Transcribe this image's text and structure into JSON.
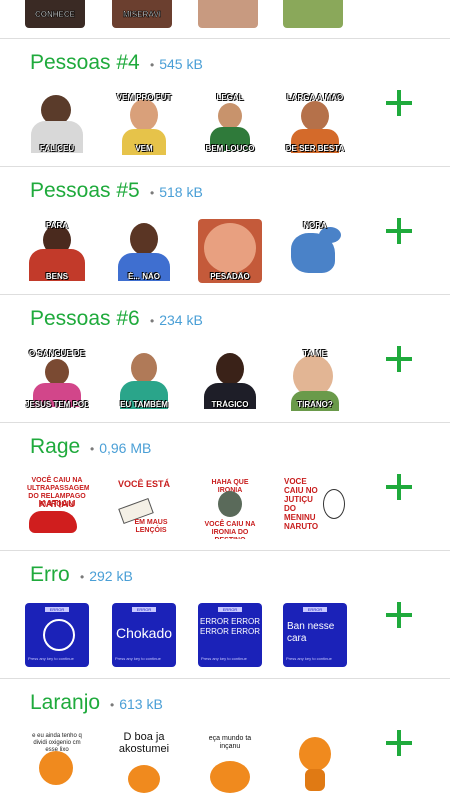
{
  "top_row": {
    "captions": [
      "CONHECE",
      "MISERAVI",
      "",
      ""
    ]
  },
  "packs": [
    {
      "title": "Pessoas #4",
      "size": "545 kB",
      "stickers": [
        {
          "top": "",
          "bottom": "FALICEU"
        },
        {
          "top": "VEM PRO FUT",
          "bottom": "VEM"
        },
        {
          "top": "LEGAL",
          "bottom": "BEM LOUCO"
        },
        {
          "top": "LARGA A MÃO",
          "bottom": "DE SER BESTA"
        }
      ]
    },
    {
      "title": "Pessoas #5",
      "size": "518 kB",
      "stickers": [
        {
          "top": "PARA",
          "bottom": "BENS"
        },
        {
          "top": "",
          "bottom": "É... NÃO"
        },
        {
          "top": "",
          "bottom": "PESADÃO"
        },
        {
          "top": "NORA",
          "bottom": ""
        }
      ]
    },
    {
      "title": "Pessoas #6",
      "size": "234 kB",
      "stickers": [
        {
          "top": "O SANGUE DE",
          "bottom": "JESUS TEM PODER"
        },
        {
          "top": "",
          "bottom": "EU TAMBÉM"
        },
        {
          "top": "",
          "bottom": "TRÁGICO"
        },
        {
          "top": "TA ME",
          "bottom": "TIRANO?"
        }
      ]
    },
    {
      "title": "Rage",
      "size": "0,96 MB",
      "stickers": [
        {
          "line1": "VOCÊ CAIU NA ULTRAPASSAGEM DO RELAMPAGO MARQUIN",
          "line2": "KATIAU"
        },
        {
          "line1": "VOCÊ ESTÁ",
          "line2": "EM MAUS LENÇÓIS"
        },
        {
          "line1": "HAHA QUE IRONIA",
          "line2": "VOCÊ CAIU NA IRONIA DO DESTINO"
        },
        {
          "line1": "VOCE CAIU NO JUTIÇU DO MENINU NARUTO",
          "line2": ""
        }
      ]
    },
    {
      "title": "Erro",
      "size": "292 kB",
      "stickers": [
        {
          "header": "ERROR",
          "main": "",
          "footer": "Press any key to continue"
        },
        {
          "header": "ERROR",
          "main": "Chokado",
          "footer": "Press any key to continue"
        },
        {
          "header": "ERROR",
          "main": "ERROR ERROR ERROR ERROR",
          "footer": "Press any key to continue"
        },
        {
          "header": "ERROR",
          "main": "Ban nesse cara",
          "footer": "Press any key to continue"
        }
      ]
    },
    {
      "title": "Laranjo",
      "size": "613 kB",
      "stickers": [
        {
          "top": "e eu ainda tenho q dividi oxigenio cm esse lixo"
        },
        {
          "top": "D boa ja akostumei"
        },
        {
          "top": "eça mundo ta inçanu"
        },
        {
          "top": ""
        }
      ]
    }
  ],
  "colors": {
    "title": "#1faa3c",
    "size": "#4a9fd6",
    "add": "#1faa3c",
    "divider": "#dedede"
  },
  "icons": {
    "add": "plus-icon",
    "bullet": "dot-separator"
  }
}
